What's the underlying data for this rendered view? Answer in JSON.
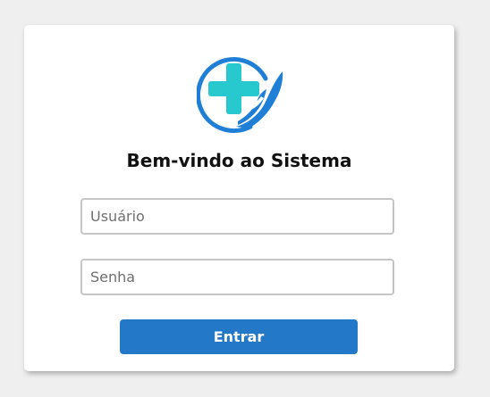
{
  "login": {
    "title": "Bem-vindo ao Sistema",
    "username_placeholder": "Usuário",
    "username_value": "",
    "password_placeholder": "Senha",
    "password_value": "",
    "submit_label": "Entrar"
  },
  "logo": {
    "icon": "medical-cross-hand-icon",
    "colors": {
      "ring": "#1f7fd6",
      "cross": "#27c9cf",
      "hand": "#1f7fd6"
    }
  },
  "colors": {
    "page_background": "#efefef",
    "card_background": "#ffffff",
    "button": "#2378c8",
    "button_text": "#ffffff",
    "input_border": "#c6c6c6"
  }
}
